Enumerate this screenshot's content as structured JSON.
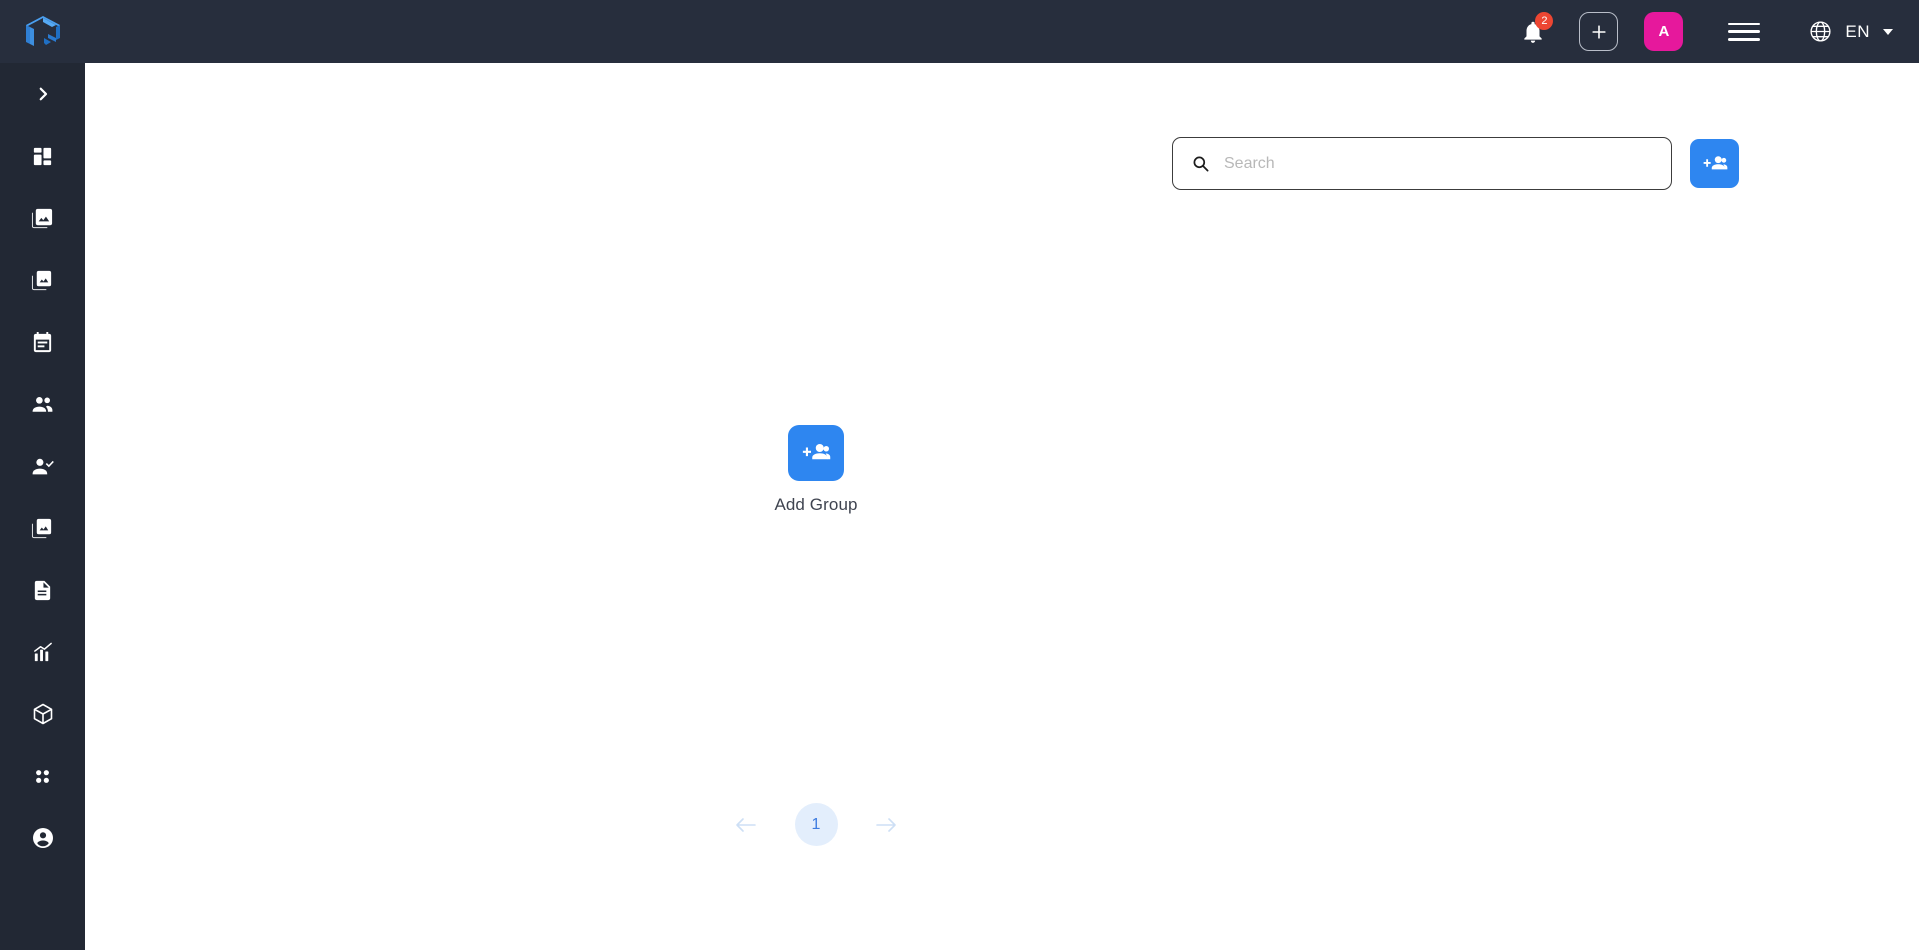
{
  "brand": {
    "logo_icon": "cube-logo-icon",
    "logo_color": "#2f86e8"
  },
  "topbar": {
    "background": "#272e3d",
    "notifications": {
      "icon": "bell-icon",
      "badge_count": "2",
      "badge_color": "#ed4632"
    },
    "add_button": {
      "icon": "plus-icon",
      "label": "+"
    },
    "avatar": {
      "initial": "A",
      "color": "#e6189c"
    },
    "menu_button": {
      "icon": "hamburger-menu-icon"
    },
    "language": {
      "icon": "globe-icon",
      "value": "EN",
      "caret": "chevron-down-icon"
    }
  },
  "sidebar": {
    "background": "#222834",
    "toggle": {
      "icon": "chevron-right-icon"
    },
    "items": [
      {
        "icon": "dashboard-grid-icon",
        "name": "dashboard"
      },
      {
        "icon": "photo-library-icon",
        "name": "media-library"
      },
      {
        "icon": "image-icon",
        "name": "images"
      },
      {
        "icon": "calendar-event-icon",
        "name": "events"
      },
      {
        "icon": "people-group-icon",
        "name": "groups"
      },
      {
        "icon": "person-check-icon",
        "name": "attendance"
      },
      {
        "icon": "photo-icon",
        "name": "gallery"
      },
      {
        "icon": "document-icon",
        "name": "documents"
      },
      {
        "icon": "bar-chart-icon",
        "name": "reports"
      },
      {
        "icon": "cube-icon",
        "name": "packages"
      },
      {
        "icon": "apps-grid-icon",
        "name": "apps"
      },
      {
        "icon": "account-circle-icon",
        "name": "account"
      }
    ]
  },
  "main": {
    "search": {
      "icon": "search-icon",
      "placeholder": "Search",
      "value": ""
    },
    "group_add_button": {
      "icon": "group-add-icon"
    },
    "add_group_tile": {
      "icon": "group-add-icon",
      "label": "Add Group",
      "color": "#2e86f0"
    },
    "pagination": {
      "prev_icon": "arrow-left-icon",
      "next_icon": "arrow-right-icon",
      "current_page": "1"
    }
  }
}
